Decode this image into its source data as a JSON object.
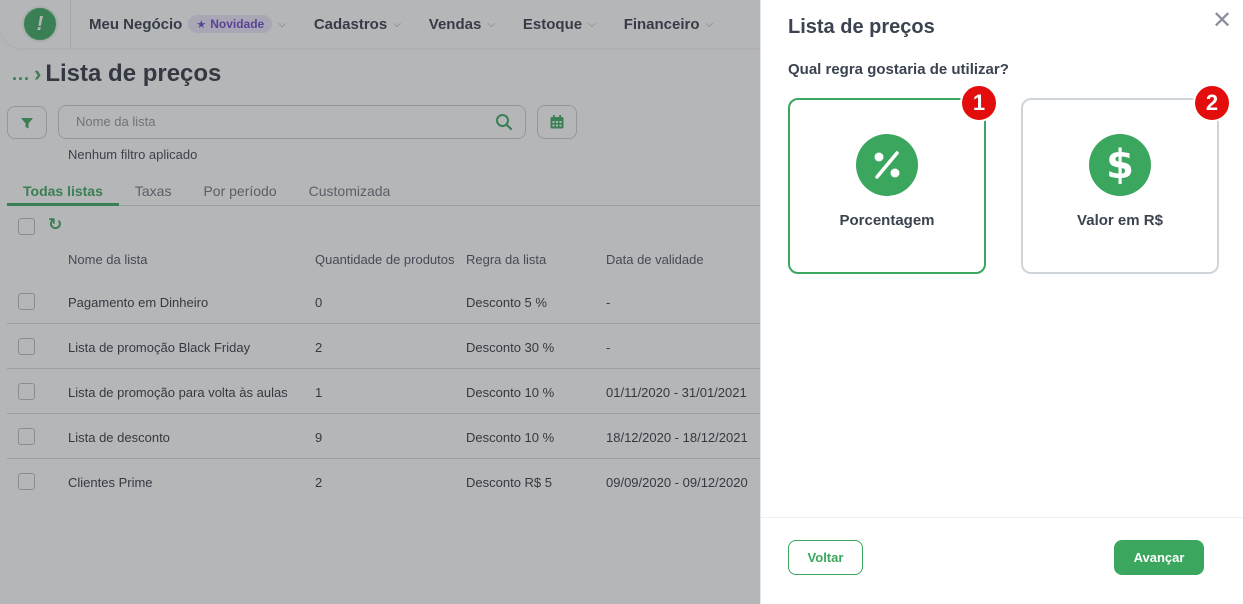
{
  "topbar": {
    "logo_glyph": "!",
    "nav": [
      {
        "label": "Meu Negócio",
        "badge": "Novidade"
      },
      {
        "label": "Cadastros"
      },
      {
        "label": "Vendas"
      },
      {
        "label": "Estoque"
      },
      {
        "label": "Financeiro"
      }
    ]
  },
  "breadcrumb": {
    "ellipsis": "...",
    "title": "Lista de preços"
  },
  "search": {
    "placeholder": "Nome da lista"
  },
  "filter_status": "Nenhum filtro aplicado",
  "tabs": [
    "Todas listas",
    "Taxas",
    "Por período",
    "Customizada"
  ],
  "active_tab": "Todas listas",
  "table": {
    "headers": [
      "Nome da lista",
      "Quantidade de produtos",
      "Regra da lista",
      "Data de validade"
    ],
    "rows": [
      [
        "Pagamento em Dinheiro",
        "0",
        "Desconto 5 %",
        "-"
      ],
      [
        "Lista de promoção Black Friday",
        "2",
        "Desconto 30 %",
        "-"
      ],
      [
        "Lista de promoção para volta às aulas",
        "1",
        "Desconto 10 %",
        "01/11/2020 - 31/01/2021"
      ],
      [
        "Lista de desconto",
        "9",
        "Desconto 10 %",
        "18/12/2020 - 18/12/2021"
      ],
      [
        "Clientes Prime",
        "2",
        "Desconto R$ 5",
        "09/09/2020 - 09/12/2020"
      ]
    ]
  },
  "panel": {
    "title": "Lista de preços",
    "question": "Qual regra gostaria de utilizar?",
    "options": [
      {
        "label": "Porcentagem",
        "icon": "percent-icon",
        "number": "1",
        "selected": true
      },
      {
        "label": "Valor em R$",
        "icon": "dollar-icon",
        "number": "2",
        "selected": false
      }
    ],
    "back_label": "Voltar",
    "next_label": "Avançar"
  },
  "colors": {
    "accent": "#3aa65e",
    "badge_red": "#e40d0d",
    "novidade": "#6b46c6"
  }
}
